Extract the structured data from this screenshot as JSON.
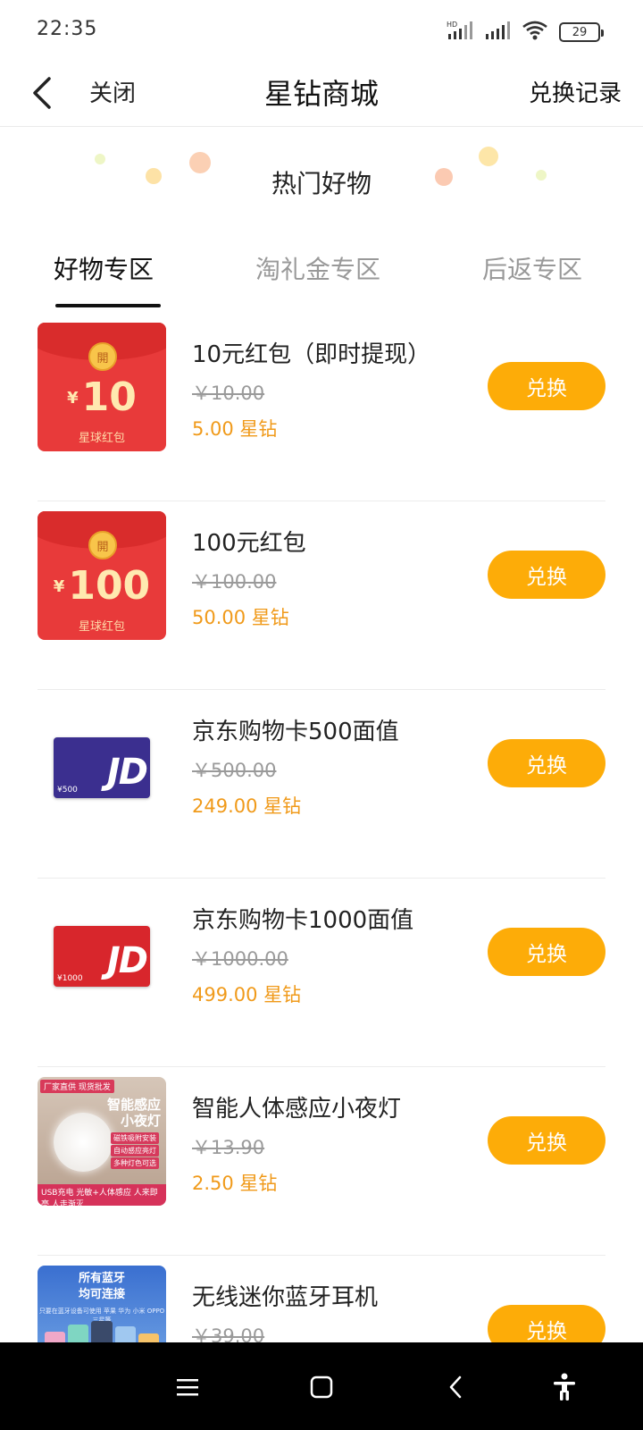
{
  "status_bar": {
    "time": "22:35",
    "network_label": "HD",
    "battery": "29"
  },
  "nav": {
    "close_label": "关闭",
    "title": "星钻商城",
    "records_label": "兑换记录"
  },
  "section": {
    "title": "热门好物"
  },
  "tabs": [
    {
      "label": "好物专区",
      "active": true
    },
    {
      "label": "淘礼金专区",
      "active": false
    },
    {
      "label": "后返专区",
      "active": false
    }
  ],
  "items": [
    {
      "name": "10元红包（即时提现）",
      "original_price": "￥10.00",
      "price": "5.00 星钻",
      "button": "兑换",
      "thumb": {
        "type": "red-envelope",
        "currency": "¥",
        "amount": "10",
        "caption": "星球红包",
        "coin": "開"
      }
    },
    {
      "name": "100元红包",
      "original_price": "￥100.00",
      "price": "50.00 星钻",
      "button": "兑换",
      "thumb": {
        "type": "red-envelope",
        "currency": "¥",
        "amount": "100",
        "caption": "星球红包",
        "coin": "開"
      }
    },
    {
      "name": "京东购物卡500面值",
      "original_price": "￥500.00",
      "price": "249.00 星钻",
      "button": "兑换",
      "thumb": {
        "type": "jd-card",
        "color": "#3b2f8f",
        "logo": "JD",
        "denomination": "¥500"
      }
    },
    {
      "name": "京东购物卡1000面值",
      "original_price": "￥1000.00",
      "price": "499.00 星钻",
      "button": "兑换",
      "thumb": {
        "type": "jd-card",
        "color": "#d8262c",
        "logo": "JD",
        "denomination": "¥1000"
      }
    },
    {
      "name": "智能人体感应小夜灯",
      "original_price": "￥13.90",
      "price": "2.50 星钻",
      "button": "兑换",
      "thumb": {
        "type": "night-light",
        "tag": "厂家直供 现货批发",
        "headline_1": "智能感应",
        "headline_2": "小夜灯",
        "features": [
          "磁铁吸附安装",
          "自动感应亮灯",
          "多种灯色可选"
        ],
        "bottom_left": "USB充电 光敏+人体感应",
        "bottom_right": "人来即亮 人走渐灭"
      }
    },
    {
      "name": "无线迷你蓝牙耳机",
      "original_price": "￥39.00",
      "price": "",
      "button": "兑换",
      "thumb": {
        "type": "earphone",
        "headline_1": "所有蓝牙",
        "headline_2": "均可连接",
        "subtext": "只要在蓝牙设备可使用 苹果 华为 小米 OPPO 三星等"
      }
    }
  ],
  "colors": {
    "accent": "#fdac08",
    "price": "#f09a1a",
    "strike": "#9a9a9a"
  },
  "system_nav": {
    "icons": [
      "menu-icon",
      "home-icon",
      "back-icon",
      "accessibility-icon"
    ]
  }
}
